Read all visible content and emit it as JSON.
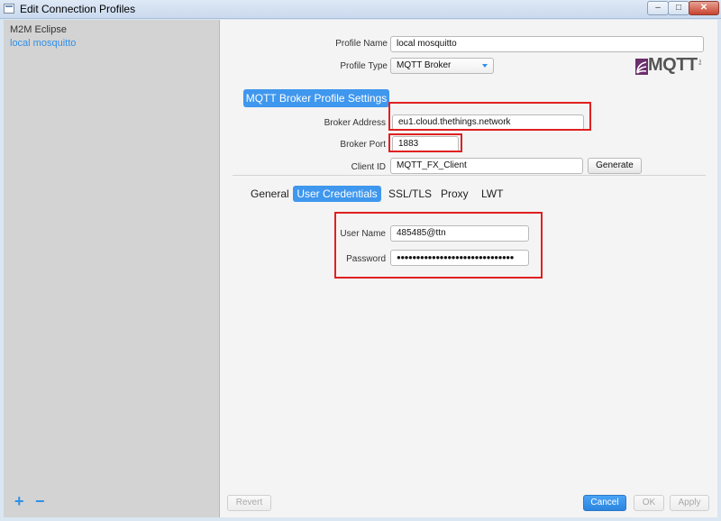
{
  "window": {
    "title": "Edit Connection Profiles",
    "minimize": "‒",
    "maximize": "□",
    "close": "✕"
  },
  "sidebar": {
    "items": [
      {
        "label": "M2M Eclipse"
      },
      {
        "label": "local mosquitto"
      }
    ],
    "add_symbol": "+",
    "remove_symbol": "−"
  },
  "profile": {
    "name_label": "Profile Name",
    "name_value": "local mosquitto",
    "type_label": "Profile Type",
    "type_value": "MQTT Broker"
  },
  "logo": {
    "text": "MQTT",
    "small": ".org"
  },
  "broker": {
    "section_title": "MQTT Broker Profile Settings",
    "address_label": "Broker Address",
    "address_value": "eu1.cloud.thethings.network",
    "port_label": "Broker Port",
    "port_value": "1883",
    "client_id_label": "Client ID",
    "client_id_value": "MQTT_FX_Client",
    "generate_label": "Generate"
  },
  "tabs": [
    {
      "label": "General"
    },
    {
      "label": "User Credentials"
    },
    {
      "label": "SSL/TLS"
    },
    {
      "label": "Proxy"
    },
    {
      "label": "LWT"
    }
  ],
  "credentials": {
    "user_label": "User Name",
    "user_value": "485485@ttn",
    "password_label": "Password",
    "password_value": "●●●●●●●●●●●●●●●●●●●●●●●●●●●●●●"
  },
  "footer": {
    "revert_label": "Revert",
    "cancel_label": "Cancel",
    "ok_label": "OK",
    "apply_label": "Apply"
  },
  "colors": {
    "accent": "#3f97ee",
    "highlight_box": "#e02020",
    "sidebar_bg": "#d3d3d3"
  }
}
